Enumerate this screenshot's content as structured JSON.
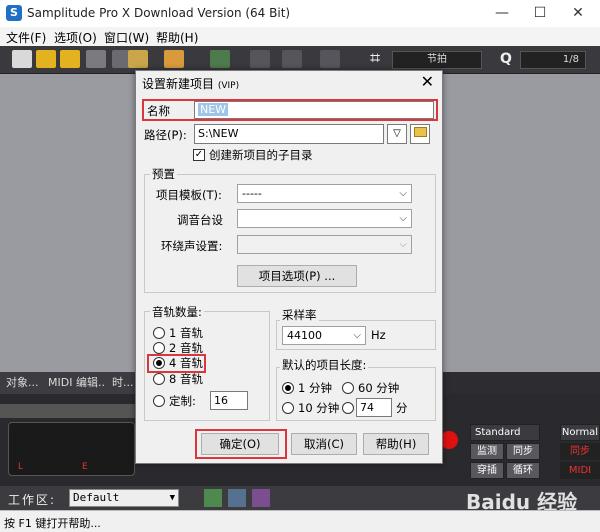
{
  "app": {
    "icon_letter": "S",
    "title": "Samplitude Pro X Download Version (64 Bit)",
    "min": "—",
    "max": "☐",
    "close": "✕"
  },
  "menu": [
    "文件(F)",
    "选项(O)",
    "窗口(W)",
    "帮助(H)"
  ],
  "toolbar": {
    "grid_symbol": "⌗",
    "beat_label": "节拍",
    "zoom_symbol": "Q",
    "zoom_value": "1/8"
  },
  "panel_tabs": [
    "对象...",
    "MIDI 编辑...",
    "时..."
  ],
  "transport": {
    "ruler_number": "1",
    "counter_markers": [
      "L",
      "E"
    ],
    "standard_label": "Standard",
    "normal_label": "Normal",
    "buttons": [
      "监测",
      "同步",
      "穿插",
      "循环"
    ],
    "side_buttons": [
      "同步",
      "MIDI"
    ]
  },
  "workspace": {
    "label": "工作区:",
    "value": "Default"
  },
  "status": {
    "text": "按 F1 键打开帮助..."
  },
  "watermark": "Baidu 经验",
  "dialog": {
    "title": "设置新建项目",
    "title_suffix": "(VIP)",
    "close": "✕",
    "name_label": "名称",
    "name_value": "NEW",
    "path_label": "路径(P):",
    "path_value": "S:\\NEW",
    "create_subdir_label": "创建新项目的子目录",
    "create_subdir_checked": true,
    "presets": {
      "title": "预置",
      "template_label": "项目模板(T):",
      "template_value": "-----",
      "mixer_label": "调音台设",
      "surround_label": "环绕声设置:",
      "options_button": "项目选项(P) ..."
    },
    "tracks": {
      "title": "音轨数量:",
      "options": [
        "1 音轨",
        "2 音轨",
        "4 音轨",
        "8 音轨"
      ],
      "selected": "4 音轨",
      "custom_label": "定制:",
      "custom_value": "16"
    },
    "samplerate": {
      "title": "采样率",
      "value": "44100",
      "unit": "Hz"
    },
    "length": {
      "title": "默认的项目长度:",
      "options": [
        "1 分钟",
        "60 分钟",
        "10 分钟"
      ],
      "selected": "1 分钟",
      "custom_value": "74",
      "custom_unit": "分"
    },
    "buttons": {
      "ok": "确定(O)",
      "cancel": "取消(C)",
      "help": "帮助(H)"
    }
  }
}
